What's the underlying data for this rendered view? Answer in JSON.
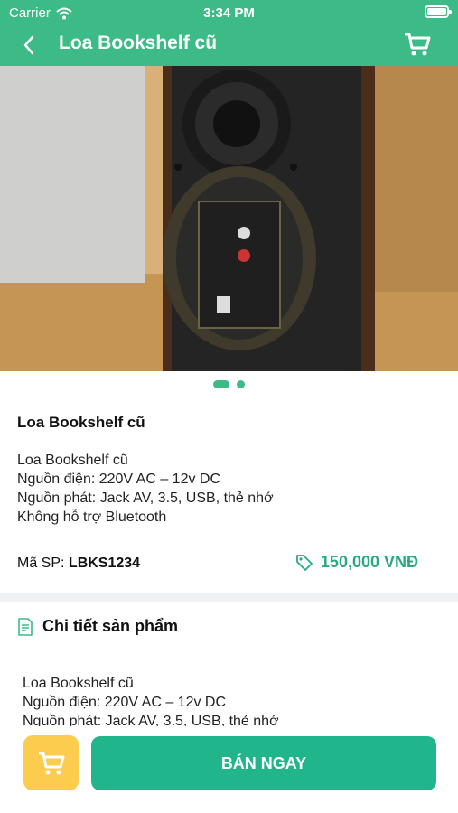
{
  "status": {
    "carrier": "Carrier",
    "time": "3:34 PM"
  },
  "nav": {
    "title": "Loa Bookshelf cũ"
  },
  "product": {
    "name": "Loa Bookshelf cũ",
    "description": [
      "Loa Bookshelf cũ",
      "Nguồn điện: 220V AC – 12v DC",
      "Nguồn phát: Jack AV, 3.5, USB, thẻ nhớ",
      "Không hỗ trợ Bluetooth"
    ],
    "code_label": "Mã SP:",
    "code": "LBKS1234",
    "price": "150,000 VNĐ",
    "image_count": 2,
    "image_index": 1
  },
  "details": {
    "title": "Chi tiết sản phẩm",
    "lines": [
      "Loa Bookshelf cũ",
      "Nguồn điện: 220V AC – 12v DC",
      "Nguồn phát: Jack AV, 3.5, USB, thẻ nhớ"
    ]
  },
  "actions": {
    "buy_label": "BÁN NGAY"
  },
  "colors": {
    "primary": "#3dbb86",
    "buy": "#20b58b",
    "cart": "#fbcc4d"
  }
}
